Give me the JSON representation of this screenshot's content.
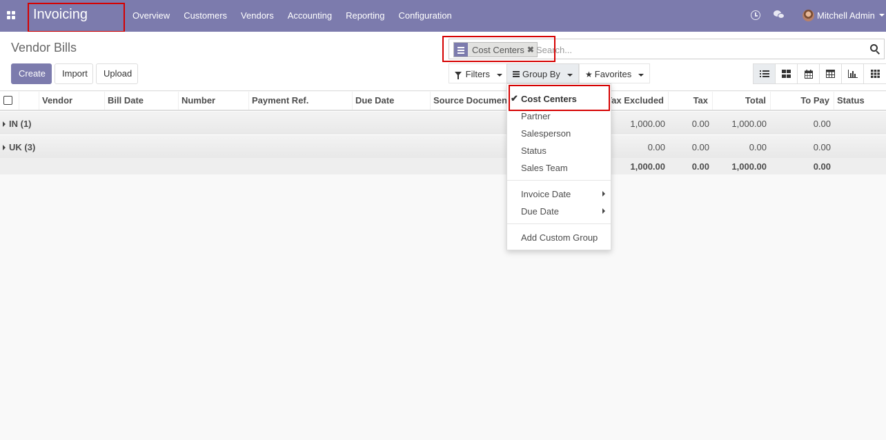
{
  "navbar": {
    "brand": "Invoicing",
    "menu": [
      "Overview",
      "Customers",
      "Vendors",
      "Accounting",
      "Reporting",
      "Configuration"
    ],
    "user": "Mitchell Admin"
  },
  "control": {
    "title": "Vendor Bills",
    "buttons": {
      "create": "Create",
      "import": "Import",
      "upload": "Upload"
    },
    "search": {
      "facet": "Cost Centers",
      "facet_close": "✖",
      "placeholder": "Search..."
    },
    "filters": "Filters",
    "group_by": "Group By",
    "favorites": "Favorites"
  },
  "table": {
    "columns": [
      "Vendor",
      "Bill Date",
      "Number",
      "Payment Ref.",
      "Due Date",
      "Source Document",
      "Tax Excluded",
      "Tax",
      "Total",
      "To Pay",
      "Status"
    ],
    "groups": [
      {
        "name": "IN (1)",
        "tax_excluded": "1,000.00",
        "tax": "0.00",
        "total": "1,000.00",
        "to_pay": "0.00"
      },
      {
        "name": "UK (3)",
        "tax_excluded": "0.00",
        "tax": "0.00",
        "total": "0.00",
        "to_pay": "0.00"
      }
    ],
    "totals": {
      "tax_excluded": "1,000.00",
      "tax": "0.00",
      "total": "1,000.00",
      "to_pay": "0.00"
    }
  },
  "group_by_menu": {
    "items": [
      "Cost Centers",
      "Partner",
      "Salesperson",
      "Status",
      "Sales Team"
    ],
    "date_items": [
      "Invoice Date",
      "Due Date"
    ],
    "custom": "Add Custom Group",
    "checked": "Cost Centers"
  }
}
